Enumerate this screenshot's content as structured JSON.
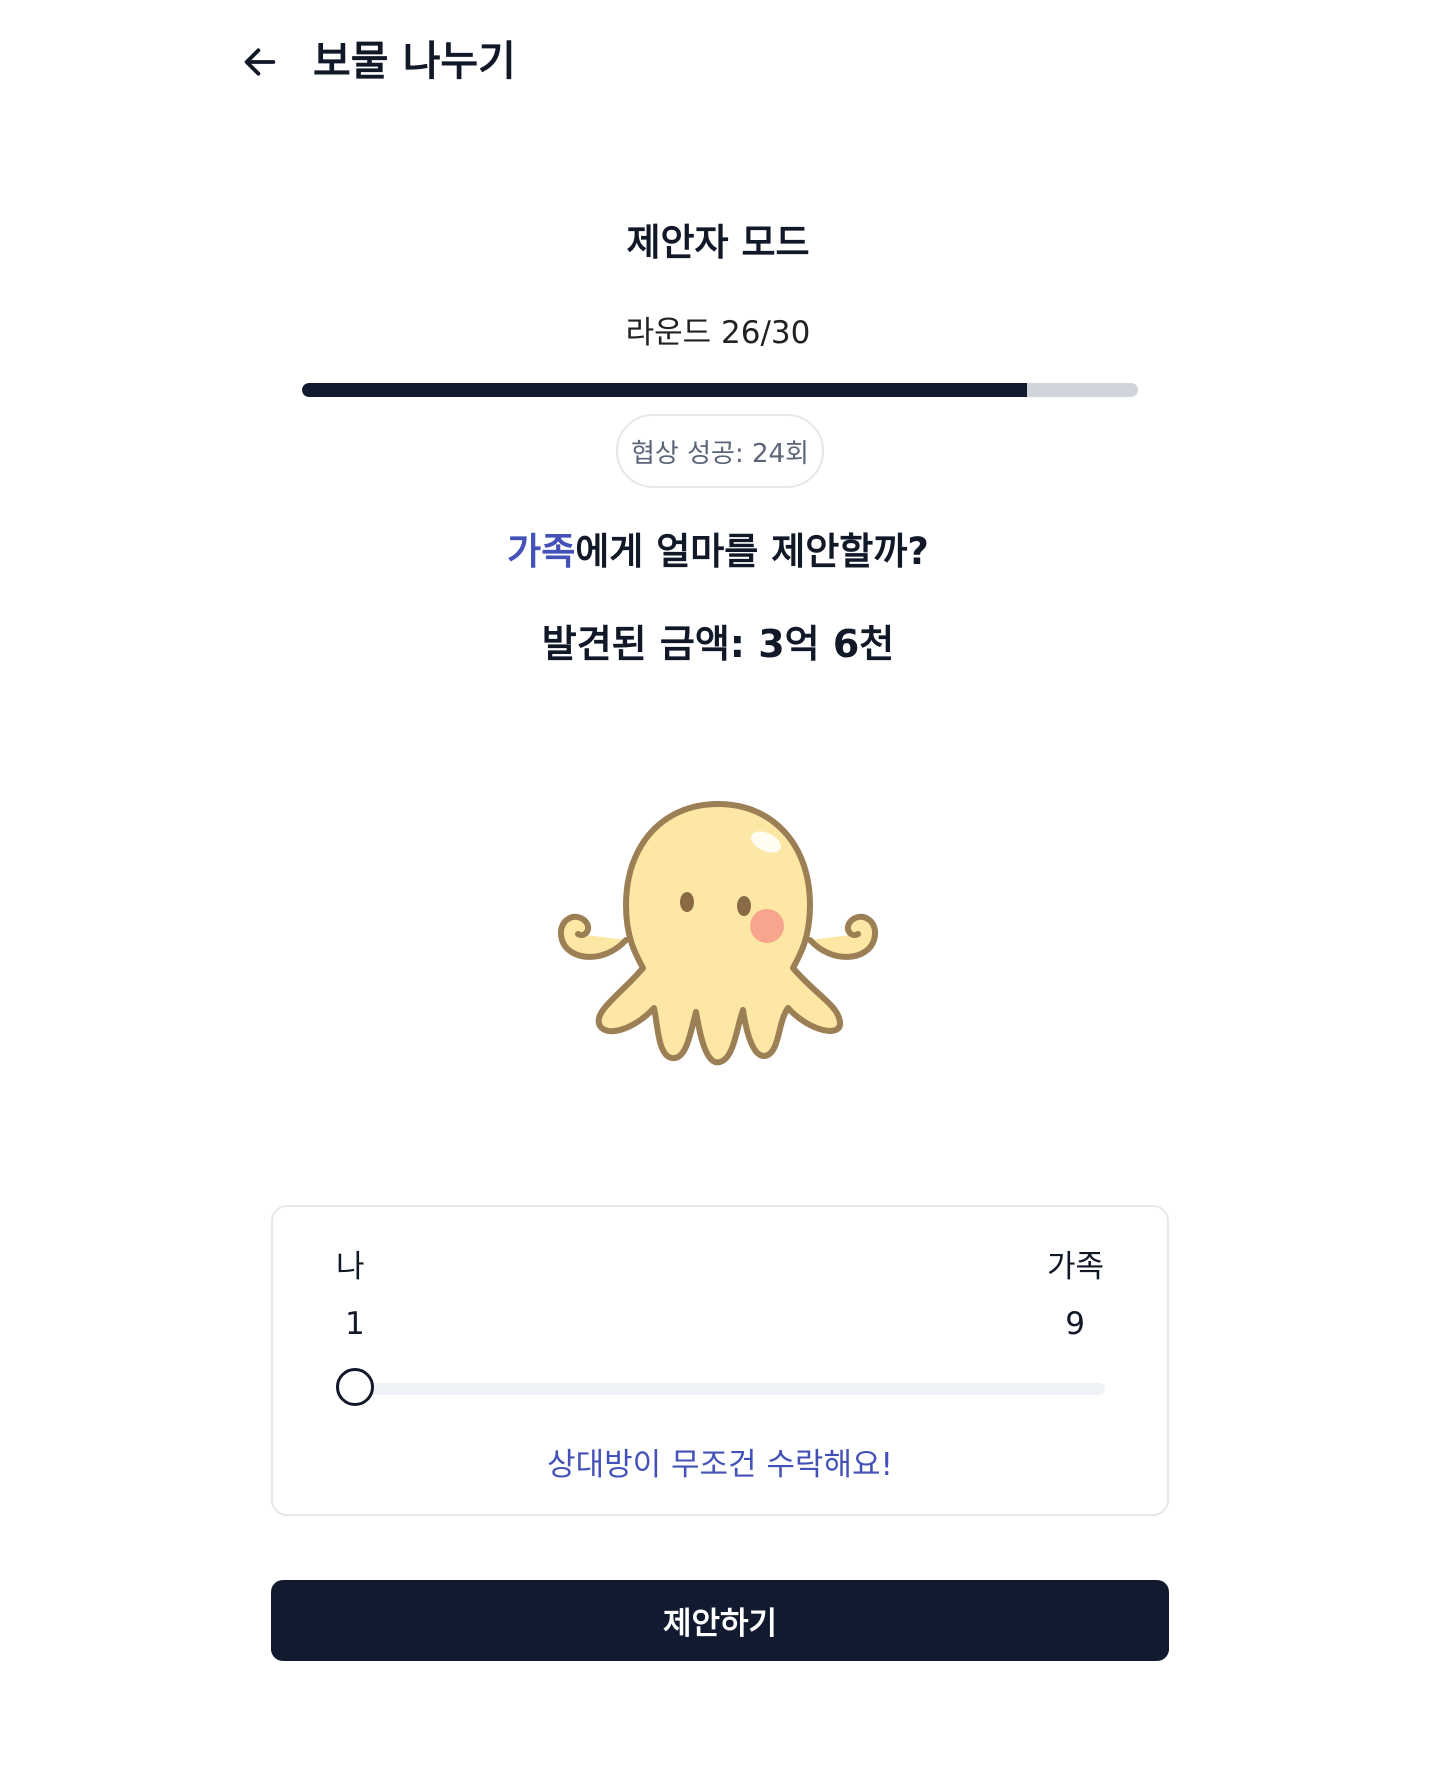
{
  "header": {
    "back_icon": "arrow-left-icon",
    "title": "보물 나누기"
  },
  "game": {
    "mode_title": "제안자 모드",
    "round_label": "라운드 26/30",
    "round_progress": 0.8667,
    "success_badge": "협상 성공: 24회",
    "question_target": "가족",
    "question_rest": "에게 얼마를 제안할까?",
    "amount_label": "발견된 금액: 3억 6천",
    "mascot": "octopus-mascot"
  },
  "split": {
    "me_name": "나",
    "me_value": "1",
    "other_name": "가족",
    "other_value": "9",
    "slider_min": 1,
    "slider_max": 10,
    "slider_value": 1,
    "hint": "상대방이 무조건 수락해요!"
  },
  "actions": {
    "submit_label": "제안하기"
  },
  "colors": {
    "primary": "#111a2e",
    "accent": "#4451b8",
    "track": "#d1d5db"
  }
}
